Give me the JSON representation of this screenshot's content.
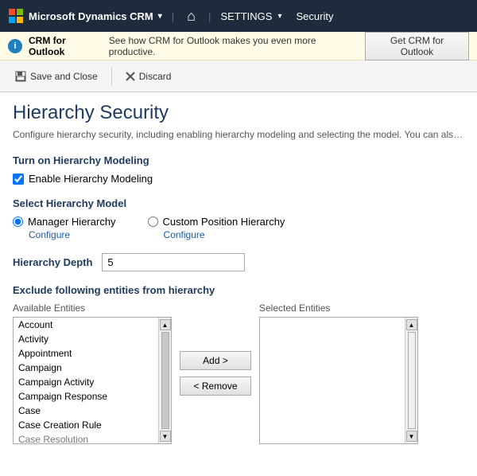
{
  "nav": {
    "logo_text": "Microsoft Dynamics CRM",
    "chevron": "▾",
    "home_icon": "⌂",
    "settings_label": "SETTINGS",
    "security_label": "Security"
  },
  "info_bar": {
    "icon": "i",
    "text": "CRM for Outlook",
    "description": "See how CRM for Outlook makes you even more productive.",
    "button_label": "Get CRM for Outlook"
  },
  "toolbar": {
    "save_close_label": "Save and Close",
    "discard_label": "Discard"
  },
  "page": {
    "title": "Hierarchy Security",
    "description": "Configure hierarchy security, including enabling hierarchy modeling and selecting the model. You can also specify h"
  },
  "hierarchy_modeling": {
    "section_title": "Turn on Hierarchy Modeling",
    "checkbox_label": "Enable Hierarchy Modeling",
    "checked": true
  },
  "hierarchy_model": {
    "section_title": "Select Hierarchy Model",
    "options": [
      {
        "label": "Manager Hierarchy",
        "selected": true,
        "configure_link": "Configure"
      },
      {
        "label": "Custom Position Hierarchy",
        "selected": false,
        "configure_link": "Configure"
      }
    ]
  },
  "hierarchy_depth": {
    "label": "Hierarchy Depth",
    "value": "5"
  },
  "entity_section": {
    "title": "Exclude following entities from hierarchy",
    "available_label": "Available Entities",
    "selected_label": "Selected Entities",
    "available_entities": [
      "Account",
      "Activity",
      "Appointment",
      "Campaign",
      "Campaign Activity",
      "Campaign Response",
      "Case",
      "Case Creation Rule",
      "Case Resolution"
    ],
    "selected_entities": [],
    "add_button": "Add >",
    "remove_button": "< Remove"
  }
}
